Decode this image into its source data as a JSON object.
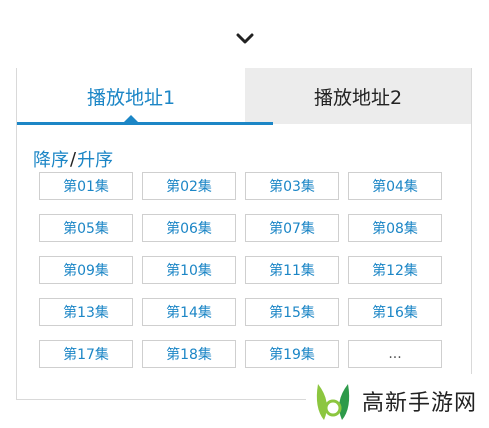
{
  "tabs": [
    {
      "label": "播放地址1",
      "active": true
    },
    {
      "label": "播放地址2",
      "active": false
    }
  ],
  "sort": {
    "desc_label": "降序",
    "separator": "/",
    "asc_label": "升序"
  },
  "episodes": [
    "第01集",
    "第02集",
    "第03集",
    "第04集",
    "第05集",
    "第06集",
    "第07集",
    "第08集",
    "第09集",
    "第10集",
    "第11集",
    "第12集",
    "第13集",
    "第14集",
    "第15集",
    "第16集",
    "第17集",
    "第18集",
    "第19集",
    "..."
  ],
  "watermark": {
    "text": "高新手游网"
  },
  "colors": {
    "accent": "#1c86c6",
    "inactive_tab_bg": "#ececec",
    "border": "#cfcfcf"
  }
}
